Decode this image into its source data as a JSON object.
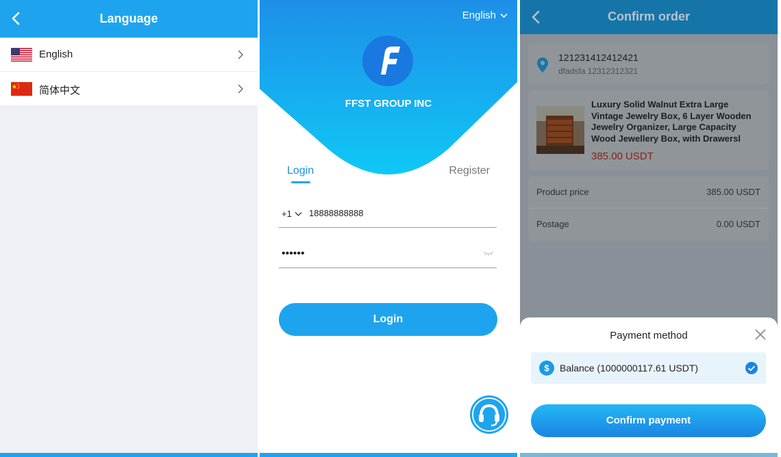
{
  "language_screen": {
    "title": "Language",
    "items": [
      {
        "label": "English",
        "flag": "us-flag-icon"
      },
      {
        "label": "简体中文",
        "flag": "cn-flag-icon"
      }
    ]
  },
  "login_screen": {
    "language_selector": "English",
    "brand": "FFST GROUP INC",
    "tabs": {
      "login": "Login",
      "register": "Register"
    },
    "phone": {
      "country_code": "+1",
      "value": "18888888888"
    },
    "password": {
      "value": "••••••"
    },
    "login_button": "Login",
    "colors": {
      "primary": "#1ea4ee",
      "hero_top": "#1e8fe8",
      "hero_bottom": "#0fc4f5"
    }
  },
  "confirm_screen": {
    "title": "Confirm order",
    "address": {
      "name": "121231412412421",
      "detail": "dfadsfa 12312312321"
    },
    "product": {
      "name": "Luxury Solid Walnut Extra Large Vintage Jewelry Box, 6 Layer Wooden Jewelry Organizer, Large Capacity Wood Jewellery Box, with Drawersl",
      "price": "385.00 USDT"
    },
    "summary": [
      {
        "label": "Product price",
        "value": "385.00 USDT"
      },
      {
        "label": "Postage",
        "value": "0.00 USDT"
      }
    ],
    "payment_sheet": {
      "title": "Payment method",
      "option": "Balance (1000000117.61 USDT)",
      "confirm_button": "Confirm payment"
    },
    "colors": {
      "price": "#8a1f16",
      "accent": "#1b84e2"
    }
  }
}
